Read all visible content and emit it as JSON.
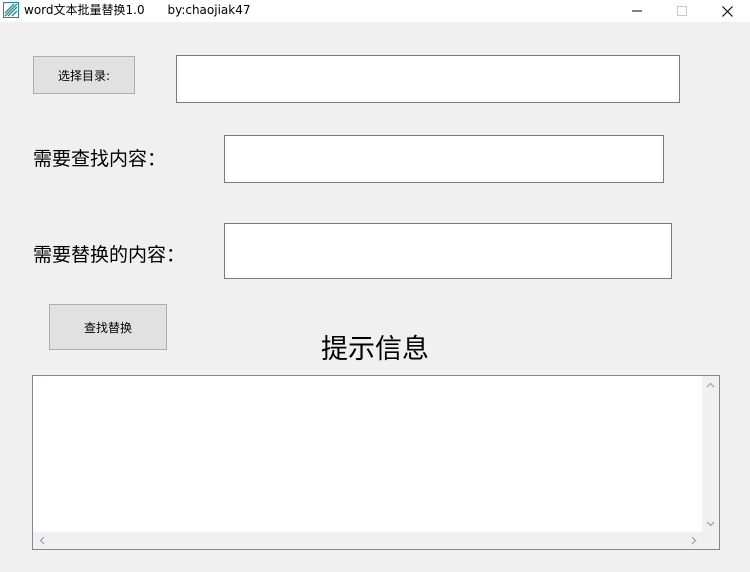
{
  "window": {
    "title": "word文本批量替换1.0      by:chaojiak47",
    "minimize_icon": "minimize-icon",
    "maximize_icon": "maximize-icon",
    "close_icon": "close-icon",
    "app_icon": "app-icon"
  },
  "directory": {
    "button_label": "选择目录:",
    "value": ""
  },
  "find": {
    "label": "需要查找内容：",
    "value": ""
  },
  "replace": {
    "label": "需要替换的内容：",
    "value": ""
  },
  "action": {
    "button_label": "查找替换"
  },
  "messages": {
    "title": "提示信息",
    "content": ""
  },
  "colors": {
    "window_bg": "#f0f0f0",
    "button_bg": "#e1e1e1",
    "app_icon": "#1e8c8c"
  }
}
